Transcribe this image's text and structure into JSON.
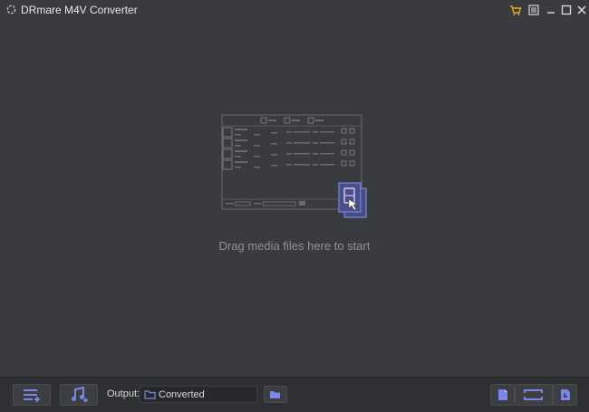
{
  "app": {
    "title": "DRmare M4V Converter"
  },
  "main": {
    "drag_hint": "Drag media files here to start"
  },
  "output": {
    "label": "Output:",
    "value": "Converted"
  },
  "colors": {
    "accent": "#7a86e8",
    "cart": "#e5a823",
    "background": "#3a3b3e",
    "bottombar": "#2f3033"
  },
  "icons": {
    "logo": "spinner-icon",
    "cart": "cart-icon",
    "menu": "menu-icon",
    "minimize": "minimize-icon",
    "maximize": "maximize-icon",
    "close": "close-icon",
    "add_files": "add-list-icon",
    "add_audio": "music-add-icon",
    "browse": "folder-icon",
    "history": "document-icon",
    "convert": "convert-icon",
    "schedule": "clock-document-icon"
  }
}
